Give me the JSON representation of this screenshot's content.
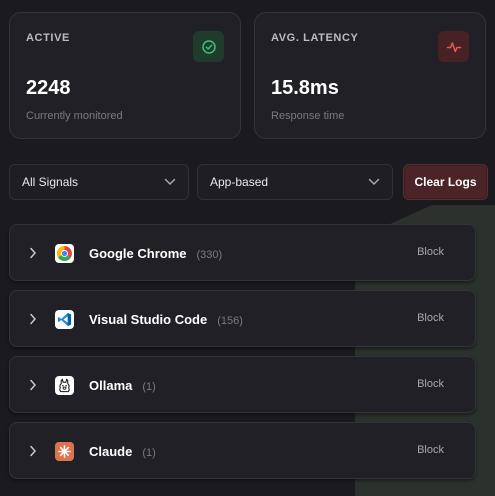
{
  "stats": [
    {
      "label": "ACTIVE",
      "value": "2248",
      "sub": "Currently monitored",
      "icon": "check-circle-icon",
      "accent": "#3fbf7a"
    },
    {
      "label": "AVG. LATENCY",
      "value": "15.8ms",
      "sub": "Response time",
      "icon": "activity-icon",
      "accent": "#e5575a"
    }
  ],
  "filters": {
    "signal": "All Signals",
    "grouping": "App-based",
    "clear_label": "Clear Logs"
  },
  "apps": [
    {
      "name": "Google Chrome",
      "count": "(330)",
      "action": "Block",
      "icon": "chrome-icon"
    },
    {
      "name": "Visual Studio Code",
      "count": "(156)",
      "action": "Block",
      "icon": "vscode-icon"
    },
    {
      "name": "Ollama",
      "count": "(1)",
      "action": "Block",
      "icon": "ollama-icon"
    },
    {
      "name": "Claude",
      "count": "(1)",
      "action": "Block",
      "icon": "claude-icon"
    }
  ]
}
